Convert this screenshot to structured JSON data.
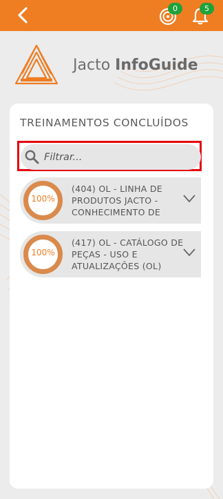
{
  "colors": {
    "accent": "#ef7d22",
    "badge": "#1fa23a",
    "highlight": "#e3000f"
  },
  "header": {
    "back_icon": "chevron-left-icon",
    "progress_badge": "0",
    "notifications_badge": "5"
  },
  "brand": {
    "name_light": "Jacto ",
    "name_bold": "InfoGuide"
  },
  "card": {
    "title": "TREINAMENTOS CONCLUÍDOS",
    "search_placeholder": "Filtrar..."
  },
  "items": [
    {
      "percent": 100,
      "percent_label": "100%",
      "title": "(404) OL - LINHA DE PRODUTOS JACTO - CONHECIMENTO DE"
    },
    {
      "percent": 100,
      "percent_label": "100%",
      "title": "(417) OL - CATÁLOGO DE PEÇAS - USO E ATUALIZAÇÕES (OL)"
    }
  ]
}
